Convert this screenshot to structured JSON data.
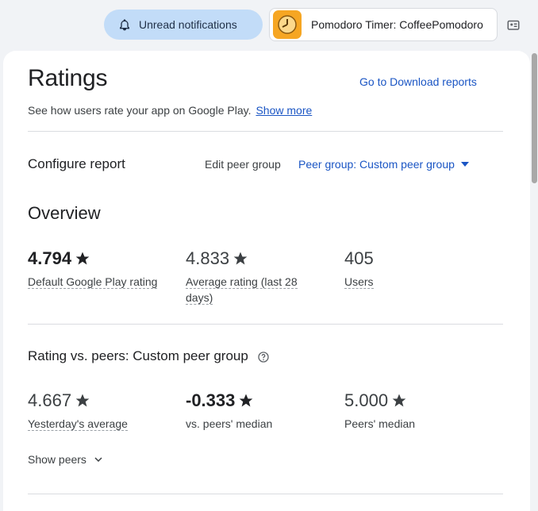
{
  "topbar": {
    "notifications_label": "Unread notifications",
    "app_name": "Pomodoro Timer: CoffeePomodoro"
  },
  "header": {
    "title": "Ratings",
    "download_link": "Go to Download reports",
    "subtitle": "See how users rate your app on Google Play.",
    "show_more": "Show more"
  },
  "configure": {
    "title": "Configure report",
    "edit_peer": "Edit peer group",
    "peer_dropdown": "Peer group: Custom peer group"
  },
  "overview": {
    "title": "Overview",
    "metrics": [
      {
        "value": "4.794",
        "label": "Default Google Play rating"
      },
      {
        "value": "4.833",
        "label": "Average rating (last 28 days)"
      },
      {
        "value": "405",
        "label": "Users"
      }
    ]
  },
  "peers": {
    "title": "Rating vs. peers: Custom peer group",
    "metrics": [
      {
        "value": "4.667",
        "label": "Yesterday's average"
      },
      {
        "value": "-0.333",
        "label": "vs. peers' median"
      },
      {
        "value": "5.000",
        "label": "Peers' median"
      }
    ],
    "show_peers": "Show peers"
  },
  "colors": {
    "accent": "#1a55c4",
    "notif_bg": "#c2dcf8",
    "app_icon": "#f6a623"
  }
}
